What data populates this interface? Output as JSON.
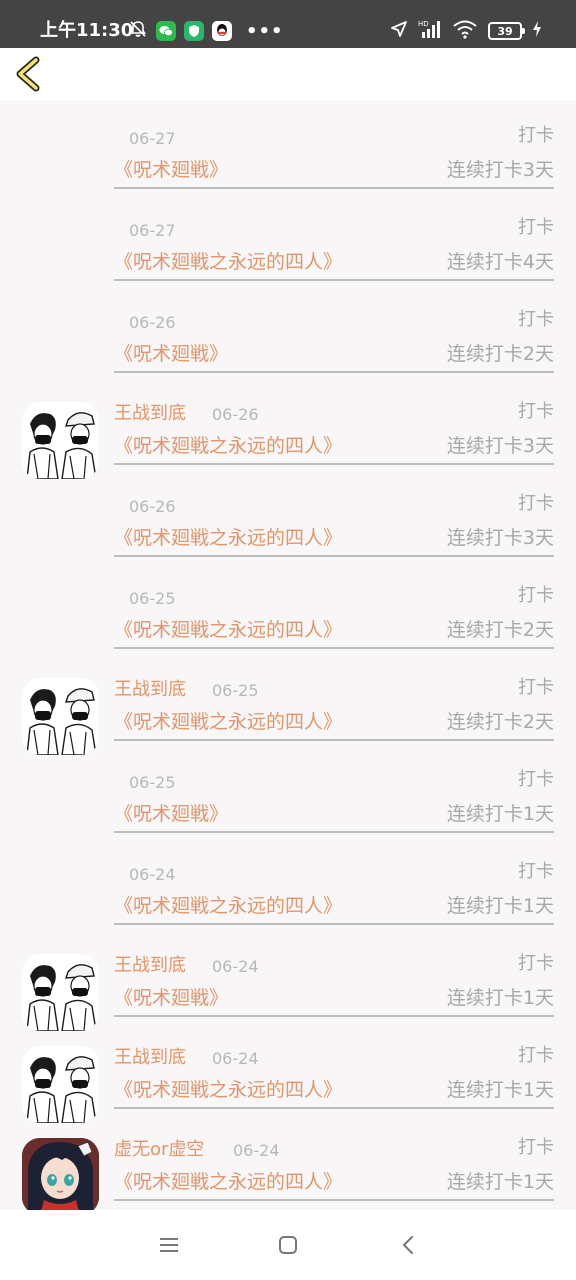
{
  "status_bar": {
    "time": "上午11:30",
    "battery": "39",
    "icons": [
      "bell-off-icon",
      "wechat-icon",
      "shield-icon",
      "qq-icon",
      "more-icon",
      "location-icon",
      "signal-icon",
      "wifi-icon",
      "battery-icon",
      "charging-icon"
    ],
    "more": "•••"
  },
  "colors": {
    "accent": "#e0966a",
    "muted": "#a8a8a8",
    "date": "#b8b8b8",
    "divider": "#bdbdbd",
    "background": "#f8f6f7",
    "status_bar": "#444444",
    "back_arrow_fill": "#f2e46a"
  },
  "records": [
    {
      "user": "",
      "date": "06-27",
      "action": "打卡",
      "book": "《呪术廻戦》",
      "streak": "连续打卡3天"
    },
    {
      "user": "",
      "date": "06-27",
      "action": "打卡",
      "book": "《呪术廻戦之永远的四人》",
      "streak": "连续打卡4天"
    },
    {
      "user": "",
      "date": "06-26",
      "action": "打卡",
      "book": "《呪术廻戦》",
      "streak": "连续打卡2天"
    },
    {
      "user": "王战到底",
      "avatar": "manga-avatar",
      "date": "06-26",
      "action": "打卡",
      "book": "《呪术廻戦之永远的四人》",
      "streak": "连续打卡3天"
    },
    {
      "user": "",
      "date": "06-26",
      "action": "打卡",
      "book": "《呪术廻戦之永远的四人》",
      "streak": "连续打卡3天"
    },
    {
      "user": "",
      "date": "06-25",
      "action": "打卡",
      "book": "《呪术廻戦之永远的四人》",
      "streak": "连续打卡2天"
    },
    {
      "user": "王战到底",
      "avatar": "manga-avatar",
      "date": "06-25",
      "action": "打卡",
      "book": "《呪术廻戦之永远的四人》",
      "streak": "连续打卡2天"
    },
    {
      "user": "",
      "date": "06-25",
      "action": "打卡",
      "book": "《呪术廻戦》",
      "streak": "连续打卡1天"
    },
    {
      "user": "",
      "date": "06-24",
      "action": "打卡",
      "book": "《呪术廻戦之永远的四人》",
      "streak": "连续打卡1天"
    },
    {
      "user": "王战到底",
      "avatar": "manga-avatar",
      "date": "06-24",
      "action": "打卡",
      "book": "《呪术廻戦》",
      "streak": "连续打卡1天"
    },
    {
      "user": "王战到底",
      "avatar": "manga-avatar",
      "date": "06-24",
      "action": "打卡",
      "book": "《呪术廻戦之永远的四人》",
      "streak": "连续打卡1天"
    },
    {
      "user": "虚无or虚空",
      "avatar": "anime-girl-avatar",
      "date": "06-24",
      "action": "打卡",
      "book": "《呪术廻戦之永远的四人》",
      "streak": "连续打卡1天"
    }
  ],
  "nav": {
    "buttons": [
      "menu-icon",
      "home-square-icon",
      "back-chevron-icon"
    ]
  }
}
